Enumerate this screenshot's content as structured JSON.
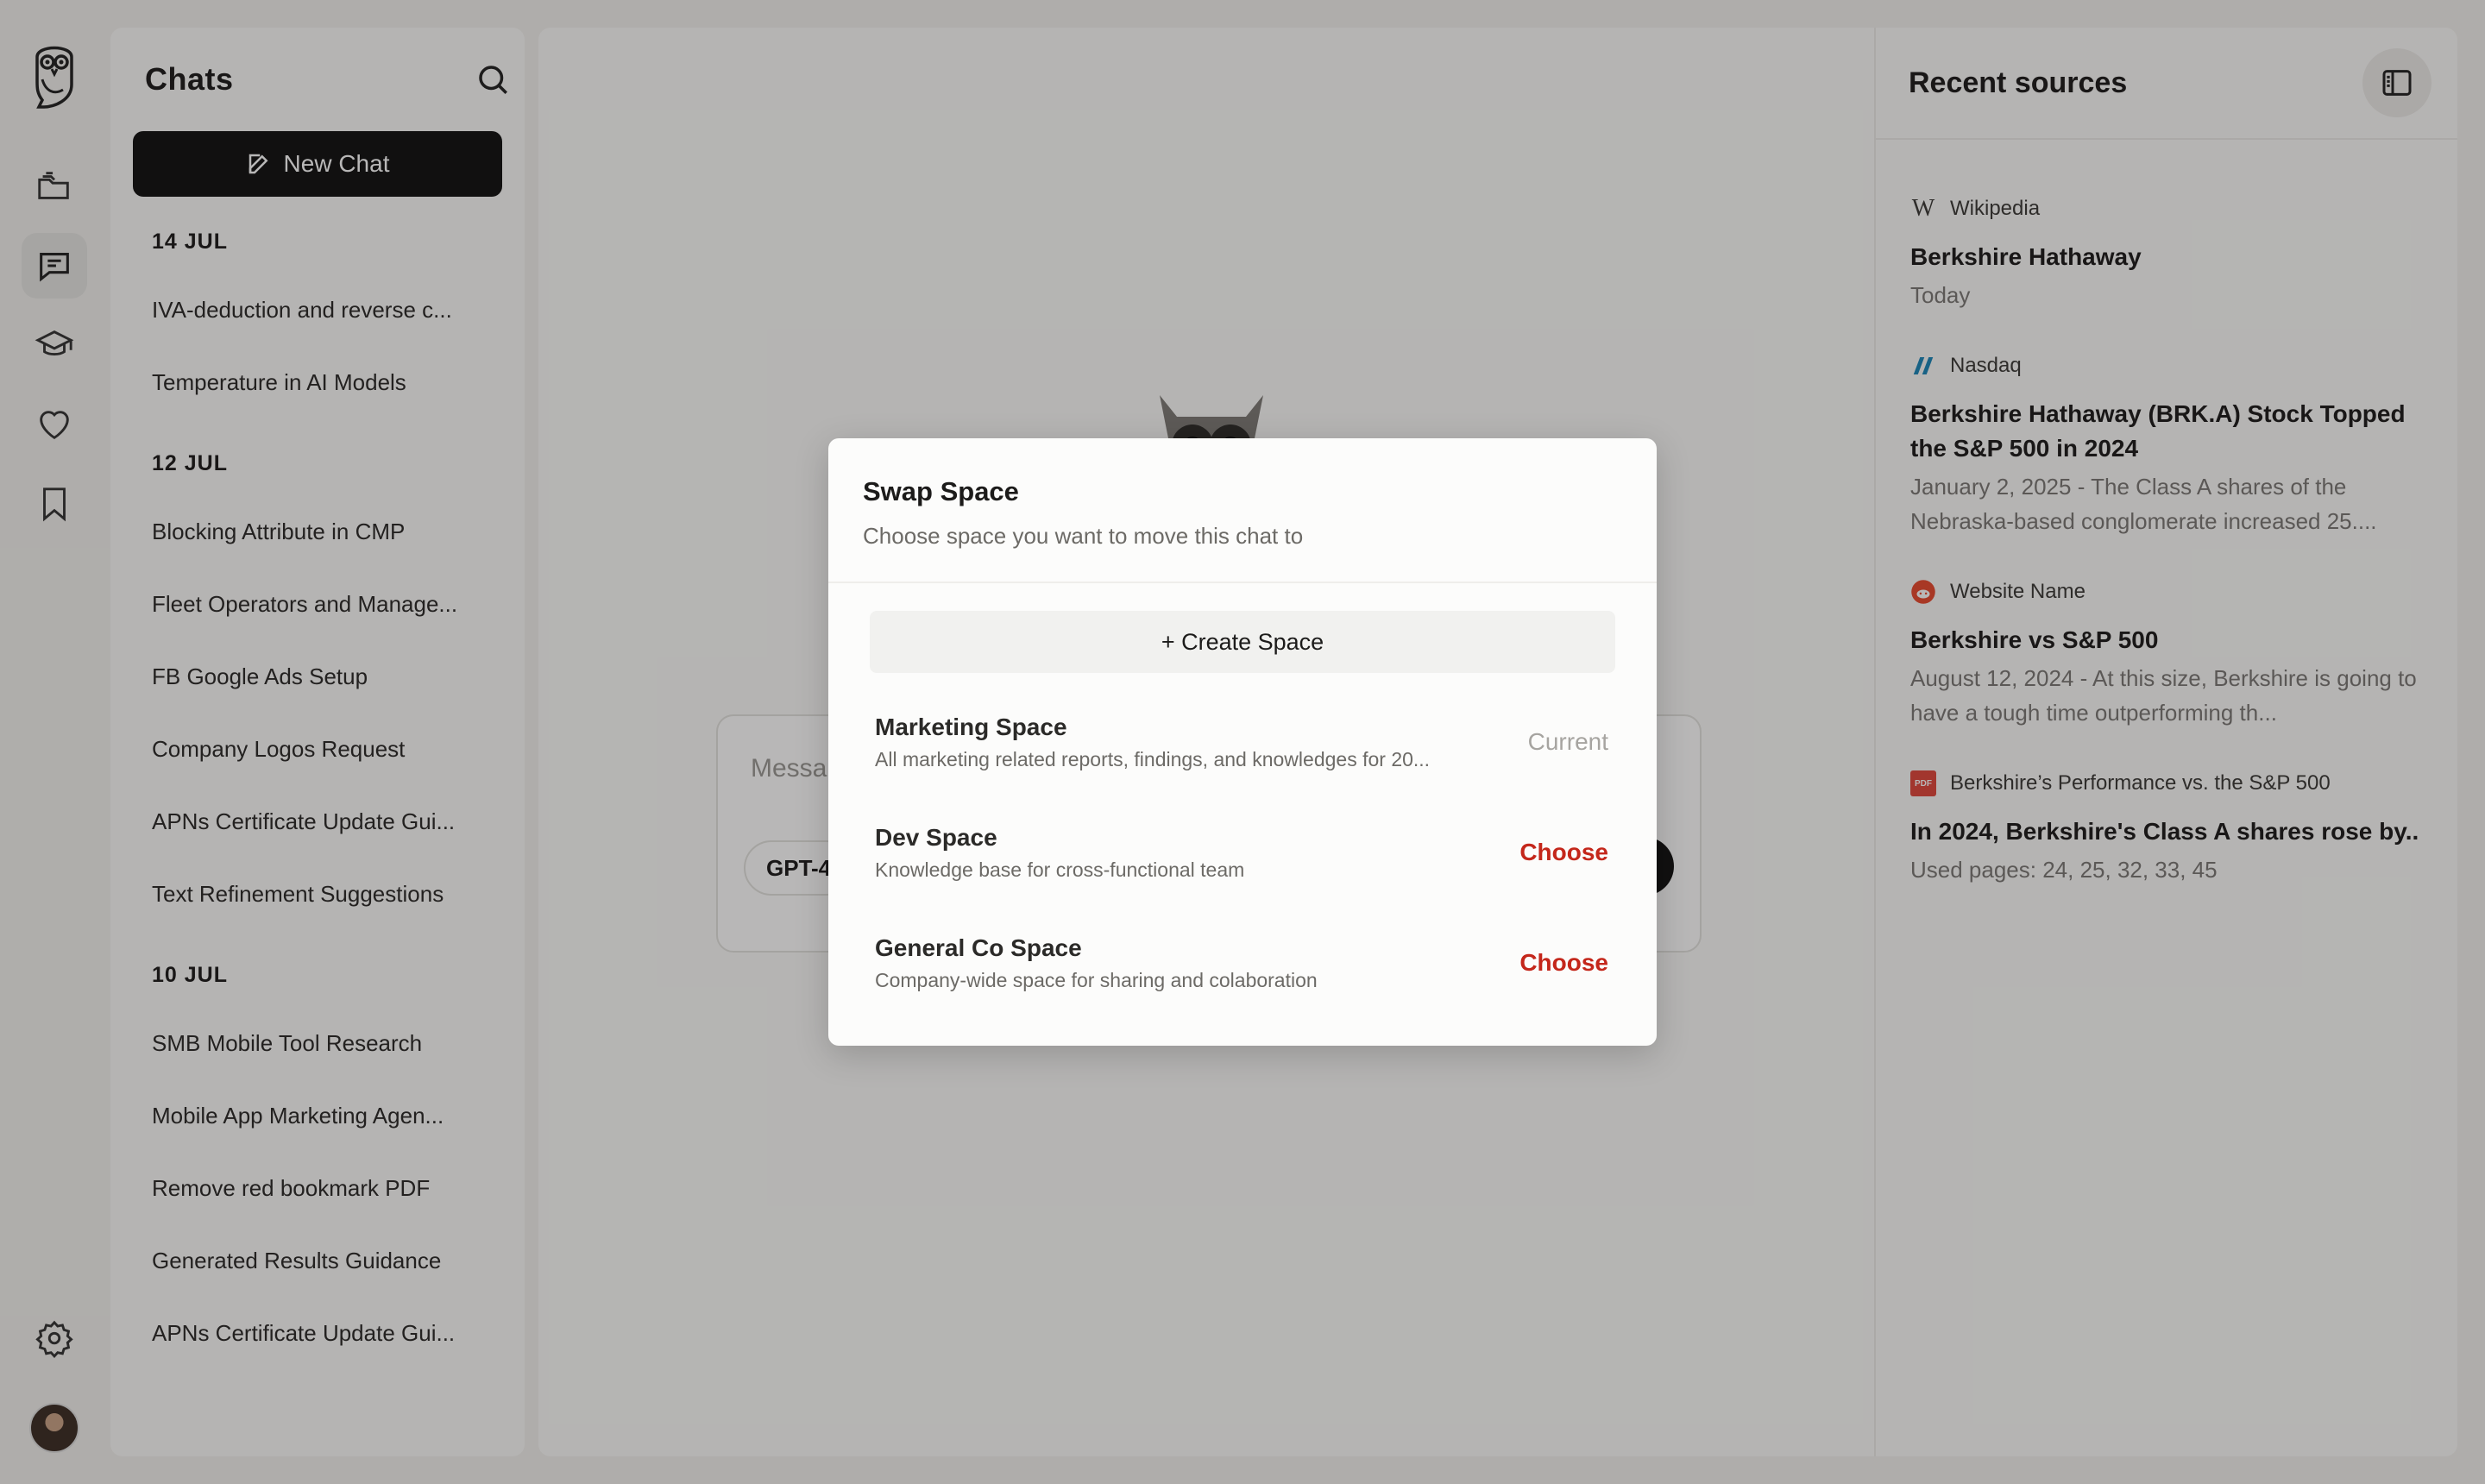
{
  "sidebar": {
    "nav": [
      {
        "icon": "folder-stack-icon"
      },
      {
        "icon": "chat-bubble-icon",
        "active": true
      },
      {
        "icon": "graduation-cap-icon"
      },
      {
        "icon": "heart-icon"
      },
      {
        "icon": "bookmark-icon"
      }
    ]
  },
  "chats": {
    "title": "Chats",
    "new_chat_label": "New Chat",
    "groups": [
      {
        "date": "14 JUL",
        "items": [
          "IVA-deduction and reverse c...",
          "Temperature in AI Models"
        ]
      },
      {
        "date": "12 JUL",
        "items": [
          "Blocking Attribute in CMP",
          "Fleet Operators and Manage...",
          "FB Google Ads Setup",
          "Company Logos Request",
          "APNs Certificate Update Gui...",
          "Text Refinement Suggestions"
        ]
      },
      {
        "date": "10 JUL",
        "items": [
          "SMB Mobile Tool Research",
          "Mobile App Marketing Agen...",
          "Remove red bookmark PDF",
          "Generated Results Guidance",
          "APNs Certificate Update Gui..."
        ]
      }
    ]
  },
  "composer": {
    "placeholder": "Messa",
    "model": "GPT-4"
  },
  "sources": {
    "title": "Recent sources",
    "items": [
      {
        "site": "Wikipedia",
        "title": "Berkshire Hathaway",
        "desc": "Today",
        "icon": "wikipedia-icon"
      },
      {
        "site": "Nasdaq",
        "title": "Berkshire Hathaway (BRK.A) Stock Topped the S&P 500 in 2024",
        "desc": "January 2, 2025 - The Class A shares of the Nebraska-based conglomerate increased 25....",
        "icon": "nasdaq-icon"
      },
      {
        "site": "Website Name",
        "title": "Berkshire vs S&P 500",
        "desc": "August 12, 2024 - At this size, Berkshire is going to have a tough time outperforming th...",
        "icon": "reddit-icon"
      },
      {
        "site": "Berkshire’s Performance vs. the S&P 500",
        "title": "In 2024, Berkshire's Class A shares rose by..",
        "desc": "Used pages: 24, 25, 32, 33, 45",
        "icon": "pdf-icon",
        "icon_label": "PDF"
      }
    ]
  },
  "modal": {
    "title": "Swap Space",
    "subtitle": "Choose space you want to move this chat to",
    "create_label": "+ Create Space",
    "spaces": [
      {
        "name": "Marketing Space",
        "desc": "All marketing related reports, findings, and knowledges for 20...",
        "action": "Current"
      },
      {
        "name": "Dev Space",
        "desc": "Knowledge base for cross-functional team",
        "action": "Choose"
      },
      {
        "name": "General Co Space",
        "desc": "Company-wide space for sharing and colaboration",
        "action": "Choose"
      }
    ]
  },
  "colors": {
    "accent_red": "#c4271b",
    "nasdaq_blue": "#1a86b8",
    "reddit_red": "#e8492f",
    "pdf_red": "#e0473b"
  }
}
